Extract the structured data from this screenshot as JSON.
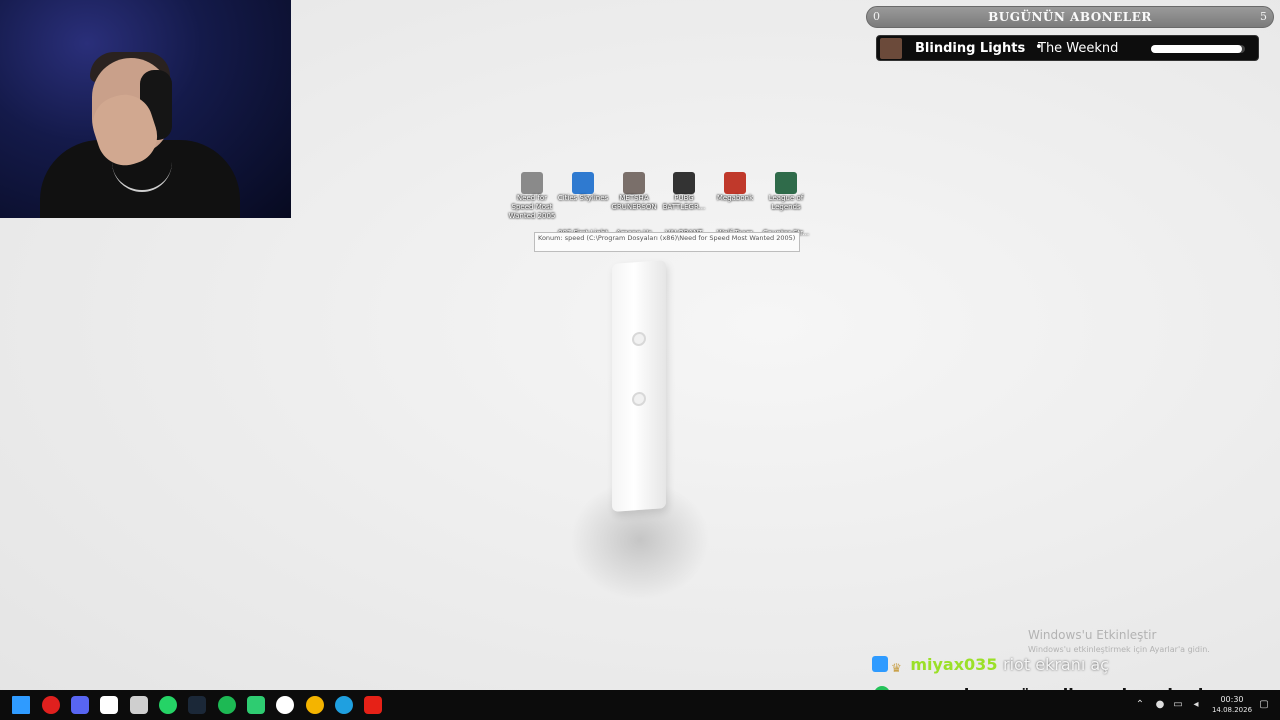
{
  "stream_overlay": {
    "subscriber_bar": {
      "title": "BUGÜNÜN ABONELER",
      "min": "0",
      "max": "5"
    },
    "now_playing": {
      "song": "Blinding Lights",
      "separator": "•",
      "artist": "The Weeknd",
      "progress": 0.97
    }
  },
  "desktop": {
    "icons": [
      {
        "label": "Need for Speed Most Wanted 2005",
        "icon": "nfs-icon",
        "color": "#8a8a8a"
      },
      {
        "label": "Cities Skylines",
        "icon": "cities-skylines-icon",
        "color": "#2f7ad0"
      },
      {
        "label": "METSHA GRUNERSON",
        "icon": "game-icon",
        "color": "#7a6f6a"
      },
      {
        "label": "PUBG BATTLEGR...",
        "icon": "pubg-icon",
        "color": "#333333"
      },
      {
        "label": "Megabonk",
        "icon": "megabonk-icon",
        "color": "#c0392b"
      },
      {
        "label": "League of Legends",
        "icon": "lol-icon",
        "color": "#2f6b4a"
      },
      {
        "label": "007 First Light",
        "icon": "game-icon",
        "color": "#dcdcdc"
      },
      {
        "label": "Among Us",
        "icon": "among-us-icon",
        "color": "#dcdcdc"
      },
      {
        "label": "VALORANT",
        "icon": "valorant-icon",
        "color": "#dcdcdc"
      },
      {
        "label": "Wolf Team Türkiye",
        "icon": "wolfteam-icon",
        "color": "#dcdcdc"
      },
      {
        "label": "Counter-Str... 2",
        "icon": "cs2-icon",
        "color": "#dcdcdc"
      }
    ],
    "tooltip": "Konum: speed (C:\\Program Dosyaları (x86)\\Need for Speed Most Wanted 2005)"
  },
  "watermark": {
    "title": "Windows'u Etkinleştir",
    "subtitle": "Windows'u etkinleştirmek için Ayarlar'a gidin."
  },
  "chat": [
    {
      "user": "miyax035",
      "text": "riot ekranı aç",
      "user_color": "#9be028"
    },
    {
      "user": "senemdoga",
      "text": "güncellemesi var kesin",
      "user_color": "#111111"
    }
  ],
  "taskbar": {
    "apps": [
      {
        "name": "windows-start-icon",
        "color": "#2f9bff"
      },
      {
        "name": "opera-icon",
        "color": "#e0201e"
      },
      {
        "name": "discord-icon",
        "color": "#5865f2"
      },
      {
        "name": "file-explorer-icon",
        "color": "#ffffff"
      },
      {
        "name": "settings-icon",
        "color": "#cfcfcf"
      },
      {
        "name": "whatsapp-icon",
        "color": "#25d366"
      },
      {
        "name": "steam-icon",
        "color": "#1b2838"
      },
      {
        "name": "spotify-icon",
        "color": "#1db954"
      },
      {
        "name": "app-green-icon",
        "color": "#2ecc71"
      },
      {
        "name": "yandex-icon",
        "color": "#ffffff"
      },
      {
        "name": "chrome-icon",
        "color": "#f4b400"
      },
      {
        "name": "edge-icon",
        "color": "#1fa0e0"
      },
      {
        "name": "youtube-icon",
        "color": "#e62117"
      }
    ],
    "clock": {
      "time": "00:30",
      "date": "14.08.2026"
    }
  }
}
